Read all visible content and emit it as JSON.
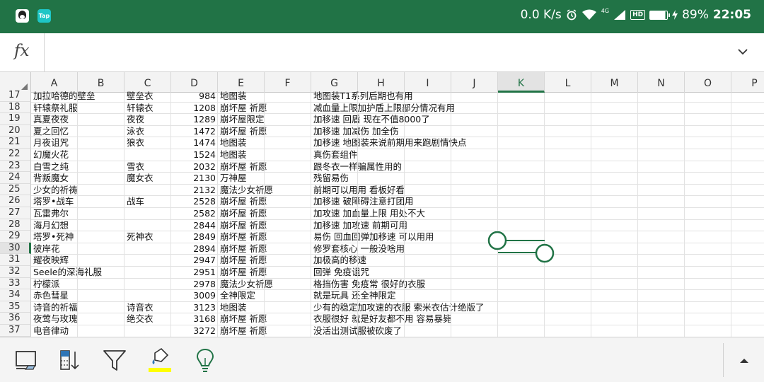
{
  "status_bar": {
    "apps": [
      "qq-icon",
      "tap-icon"
    ],
    "tap_label": "Tap",
    "speed": "0.0 K/s",
    "network": "4G",
    "hd": "HD",
    "battery": "89%",
    "time": "22:05"
  },
  "formula_bar": {
    "fx_label": "fx",
    "value": ""
  },
  "columns": [
    "A",
    "B",
    "C",
    "D",
    "E",
    "F",
    "G",
    "H",
    "I",
    "J",
    "K",
    "L",
    "M",
    "N",
    "O",
    "P"
  ],
  "selected_column": "K",
  "selected_row": "30",
  "rows": [
    {
      "n": "17",
      "a": "加拉哈德的壁垒",
      "c": "壁垒衣",
      "d": "984",
      "e": "地图装",
      "g": "地图装T1系列后期也有用"
    },
    {
      "n": "18",
      "a": "轩辕祭礼服",
      "c": "轩辕衣",
      "d": "1208",
      "e": "崩坏屋 祈愿",
      "g": "减血量上限加护盾上限部分情况有用"
    },
    {
      "n": "19",
      "a": "真夏夜夜",
      "c": "夜夜",
      "d": "1289",
      "e": "崩坏屋限定",
      "g": "加移速 回盾 现在不值8000了"
    },
    {
      "n": "20",
      "a": "夏之回忆",
      "c": "泳衣",
      "d": "1472",
      "e": "崩坏屋 祈愿",
      "g": "加移速 加减伤 加全伤"
    },
    {
      "n": "21",
      "a": "月夜诅咒",
      "c": "狼衣",
      "d": "1474",
      "e": "地图装",
      "g": "加移速 地图装来说前期用来跑剧情快点"
    },
    {
      "n": "22",
      "a": "幻魔火花",
      "c": "",
      "d": "1524",
      "e": "地图装",
      "g": "真伤套组件"
    },
    {
      "n": "23",
      "a": "白雪之纯",
      "c": "雪衣",
      "d": "2032",
      "e": "崩坏屋 祈愿",
      "g": "跟冬衣一样骗属性用的"
    },
    {
      "n": "24",
      "a": "背叛魔女",
      "c": "魔女衣",
      "d": "2130",
      "e": "万神屋",
      "g": "残留易伤"
    },
    {
      "n": "25",
      "a": "少女的祈祷",
      "c": "",
      "d": "2132",
      "e": "魔法少女祈愿",
      "g": "前期可以用用 看板好看"
    },
    {
      "n": "26",
      "a": "塔罗•战车",
      "c": "战车",
      "d": "2528",
      "e": "崩坏屋 祈愿",
      "g": "加移速 破障碍注意打团用"
    },
    {
      "n": "27",
      "a": "瓦雷弗尔",
      "c": "",
      "d": "2582",
      "e": "崩坏屋 祈愿",
      "g": "加攻速 加血量上限 用处不大"
    },
    {
      "n": "28",
      "a": "海月幻想",
      "c": "",
      "d": "2844",
      "e": "崩坏屋 祈愿",
      "g": "加移速 加攻速 前期可用"
    },
    {
      "n": "29",
      "a": "塔罗•死神",
      "c": "死神衣",
      "d": "2849",
      "e": "崩坏屋 祈愿",
      "g": "易伤 回血回弹加移速 可以用用"
    },
    {
      "n": "30",
      "a": "彼岸花",
      "c": "",
      "d": "2894",
      "e": "崩坏屋 祈愿",
      "g": "修罗套核心 一般没啥用"
    },
    {
      "n": "31",
      "a": "耀夜映辉",
      "c": "",
      "d": "2947",
      "e": "崩坏屋 祈愿",
      "g": "加极高的移速"
    },
    {
      "n": "32",
      "a": "Seele的深海礼服",
      "c": "",
      "d": "2951",
      "e": "崩坏屋 祈愿",
      "g": "回弹 免疫诅咒"
    },
    {
      "n": "33",
      "a": "柠檬派",
      "c": "",
      "d": "2978",
      "e": "魔法少女祈愿",
      "g": "格挡伤害 免疫常 很好的衣服"
    },
    {
      "n": "34",
      "a": "赤色彗星",
      "c": "",
      "d": "3009",
      "e": "全神限定",
      "g": "就是玩具 还全神限定"
    },
    {
      "n": "35",
      "a": "诗音的祈福",
      "c": "诗音衣",
      "d": "3123",
      "e": "地图装",
      "g": "少有的稳定加攻速的衣服 索米衣估计绝版了"
    },
    {
      "n": "36",
      "a": "夜莺与玫瑰",
      "c": "绝交衣",
      "d": "3168",
      "e": "崩坏屋 祈愿",
      "g": "衣服很好 就是好友都不用 容易暴毙"
    },
    {
      "n": "37",
      "a": "电音律动",
      "c": "",
      "d": "3272",
      "e": "崩坏屋 祈愿",
      "g": "没活出测试服被砍废了"
    }
  ],
  "toolbar": {
    "buttons": [
      "select-mode-icon",
      "sort-icon",
      "filter-icon",
      "fill-color-icon",
      "ideas-bulb-icon"
    ],
    "fill_color": "#ffff00",
    "accent": "#217346"
  }
}
